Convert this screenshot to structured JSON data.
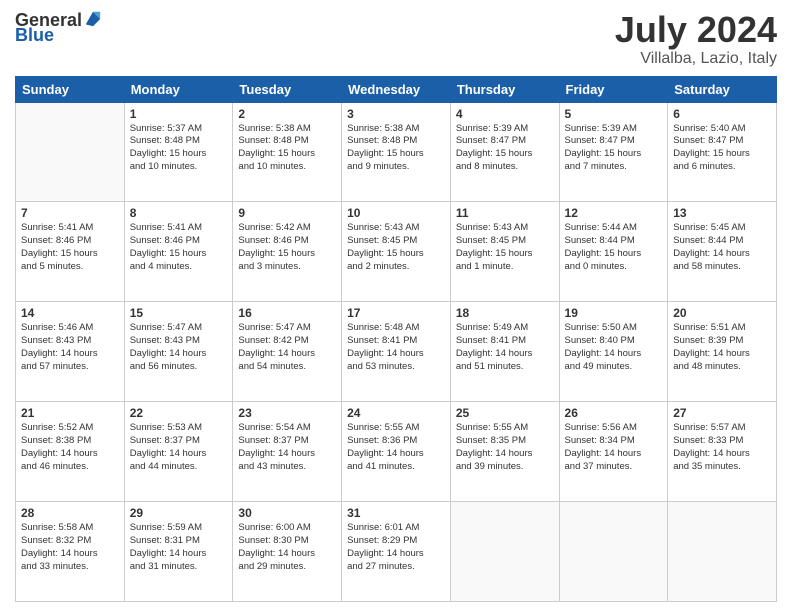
{
  "header": {
    "logo_general": "General",
    "logo_blue": "Blue",
    "month": "July 2024",
    "location": "Villalba, Lazio, Italy"
  },
  "weekdays": [
    "Sunday",
    "Monday",
    "Tuesday",
    "Wednesday",
    "Thursday",
    "Friday",
    "Saturday"
  ],
  "weeks": [
    [
      {
        "date": "",
        "info": ""
      },
      {
        "date": "1",
        "info": "Sunrise: 5:37 AM\nSunset: 8:48 PM\nDaylight: 15 hours\nand 10 minutes."
      },
      {
        "date": "2",
        "info": "Sunrise: 5:38 AM\nSunset: 8:48 PM\nDaylight: 15 hours\nand 10 minutes."
      },
      {
        "date": "3",
        "info": "Sunrise: 5:38 AM\nSunset: 8:48 PM\nDaylight: 15 hours\nand 9 minutes."
      },
      {
        "date": "4",
        "info": "Sunrise: 5:39 AM\nSunset: 8:47 PM\nDaylight: 15 hours\nand 8 minutes."
      },
      {
        "date": "5",
        "info": "Sunrise: 5:39 AM\nSunset: 8:47 PM\nDaylight: 15 hours\nand 7 minutes."
      },
      {
        "date": "6",
        "info": "Sunrise: 5:40 AM\nSunset: 8:47 PM\nDaylight: 15 hours\nand 6 minutes."
      }
    ],
    [
      {
        "date": "7",
        "info": "Sunrise: 5:41 AM\nSunset: 8:46 PM\nDaylight: 15 hours\nand 5 minutes."
      },
      {
        "date": "8",
        "info": "Sunrise: 5:41 AM\nSunset: 8:46 PM\nDaylight: 15 hours\nand 4 minutes."
      },
      {
        "date": "9",
        "info": "Sunrise: 5:42 AM\nSunset: 8:46 PM\nDaylight: 15 hours\nand 3 minutes."
      },
      {
        "date": "10",
        "info": "Sunrise: 5:43 AM\nSunset: 8:45 PM\nDaylight: 15 hours\nand 2 minutes."
      },
      {
        "date": "11",
        "info": "Sunrise: 5:43 AM\nSunset: 8:45 PM\nDaylight: 15 hours\nand 1 minute."
      },
      {
        "date": "12",
        "info": "Sunrise: 5:44 AM\nSunset: 8:44 PM\nDaylight: 15 hours\nand 0 minutes."
      },
      {
        "date": "13",
        "info": "Sunrise: 5:45 AM\nSunset: 8:44 PM\nDaylight: 14 hours\nand 58 minutes."
      }
    ],
    [
      {
        "date": "14",
        "info": "Sunrise: 5:46 AM\nSunset: 8:43 PM\nDaylight: 14 hours\nand 57 minutes."
      },
      {
        "date": "15",
        "info": "Sunrise: 5:47 AM\nSunset: 8:43 PM\nDaylight: 14 hours\nand 56 minutes."
      },
      {
        "date": "16",
        "info": "Sunrise: 5:47 AM\nSunset: 8:42 PM\nDaylight: 14 hours\nand 54 minutes."
      },
      {
        "date": "17",
        "info": "Sunrise: 5:48 AM\nSunset: 8:41 PM\nDaylight: 14 hours\nand 53 minutes."
      },
      {
        "date": "18",
        "info": "Sunrise: 5:49 AM\nSunset: 8:41 PM\nDaylight: 14 hours\nand 51 minutes."
      },
      {
        "date": "19",
        "info": "Sunrise: 5:50 AM\nSunset: 8:40 PM\nDaylight: 14 hours\nand 49 minutes."
      },
      {
        "date": "20",
        "info": "Sunrise: 5:51 AM\nSunset: 8:39 PM\nDaylight: 14 hours\nand 48 minutes."
      }
    ],
    [
      {
        "date": "21",
        "info": "Sunrise: 5:52 AM\nSunset: 8:38 PM\nDaylight: 14 hours\nand 46 minutes."
      },
      {
        "date": "22",
        "info": "Sunrise: 5:53 AM\nSunset: 8:37 PM\nDaylight: 14 hours\nand 44 minutes."
      },
      {
        "date": "23",
        "info": "Sunrise: 5:54 AM\nSunset: 8:37 PM\nDaylight: 14 hours\nand 43 minutes."
      },
      {
        "date": "24",
        "info": "Sunrise: 5:55 AM\nSunset: 8:36 PM\nDaylight: 14 hours\nand 41 minutes."
      },
      {
        "date": "25",
        "info": "Sunrise: 5:55 AM\nSunset: 8:35 PM\nDaylight: 14 hours\nand 39 minutes."
      },
      {
        "date": "26",
        "info": "Sunrise: 5:56 AM\nSunset: 8:34 PM\nDaylight: 14 hours\nand 37 minutes."
      },
      {
        "date": "27",
        "info": "Sunrise: 5:57 AM\nSunset: 8:33 PM\nDaylight: 14 hours\nand 35 minutes."
      }
    ],
    [
      {
        "date": "28",
        "info": "Sunrise: 5:58 AM\nSunset: 8:32 PM\nDaylight: 14 hours\nand 33 minutes."
      },
      {
        "date": "29",
        "info": "Sunrise: 5:59 AM\nSunset: 8:31 PM\nDaylight: 14 hours\nand 31 minutes."
      },
      {
        "date": "30",
        "info": "Sunrise: 6:00 AM\nSunset: 8:30 PM\nDaylight: 14 hours\nand 29 minutes."
      },
      {
        "date": "31",
        "info": "Sunrise: 6:01 AM\nSunset: 8:29 PM\nDaylight: 14 hours\nand 27 minutes."
      },
      {
        "date": "",
        "info": ""
      },
      {
        "date": "",
        "info": ""
      },
      {
        "date": "",
        "info": ""
      }
    ]
  ]
}
